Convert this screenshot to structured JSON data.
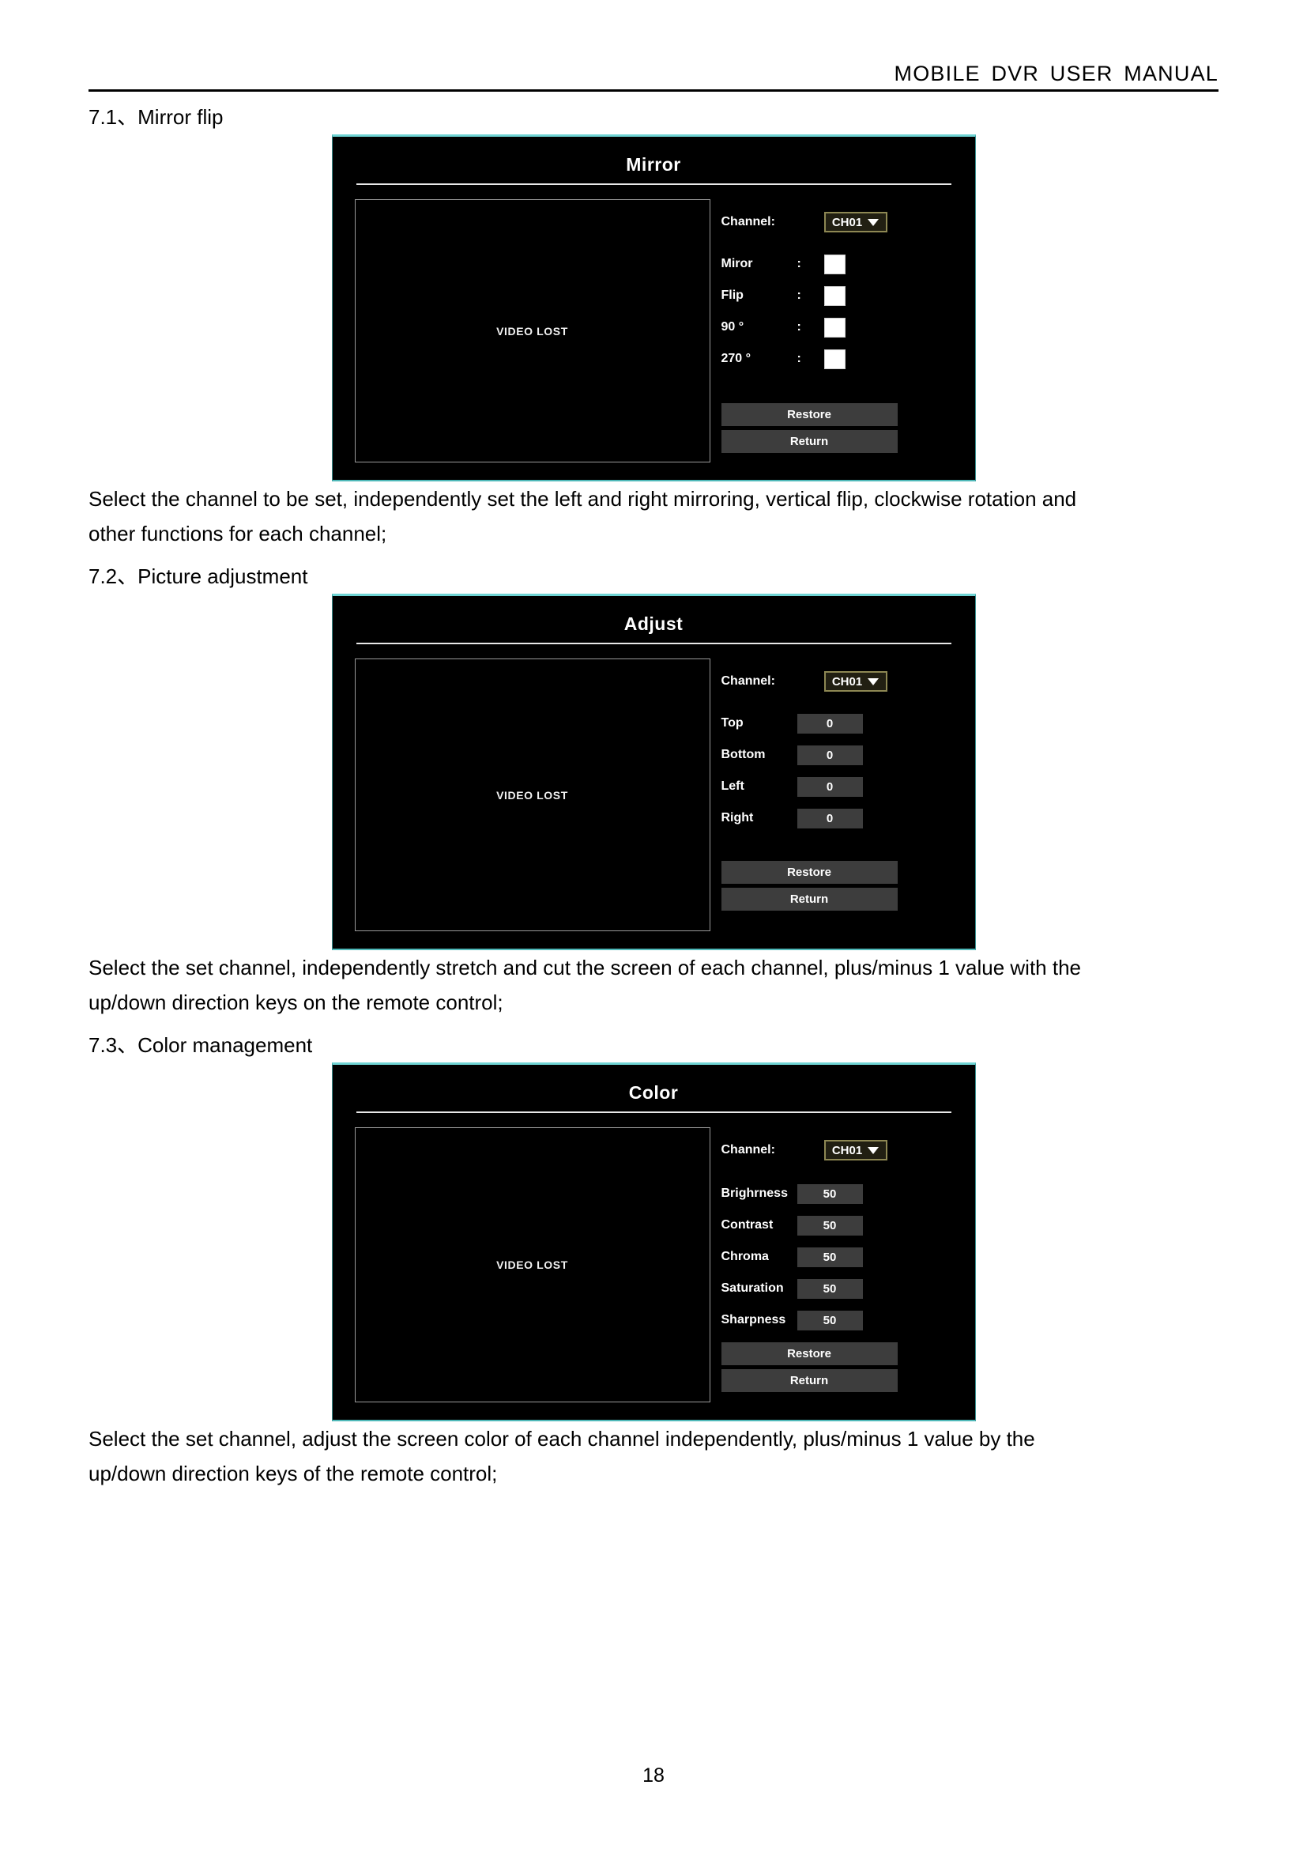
{
  "header": {
    "title": "MOBILE  DVR  USER  MANUAL"
  },
  "sections": [
    {
      "heading": "7.1、Mirror flip",
      "dialog": {
        "title": "Mirror",
        "video_placeholder": "VIDEO LOST",
        "channel_label": "Channel:",
        "channel_value": "CH01",
        "rows": [
          {
            "label": "Miror",
            "colon": ":",
            "control": "checkbox"
          },
          {
            "label": "Flip",
            "colon": ":",
            "control": "checkbox"
          },
          {
            "label": "90 °",
            "colon": ":",
            "control": "checkbox"
          },
          {
            "label": "270 °",
            "colon": ":",
            "control": "checkbox"
          }
        ],
        "buttons": [
          {
            "label": "Restore"
          },
          {
            "label": "Return"
          }
        ]
      },
      "paragraph": [
        "Select the channel to be set, independently set the left and right mirroring, vertical flip, clockwise rotation and",
        "other functions for each channel;"
      ]
    },
    {
      "heading": "7.2、Picture adjustment",
      "dialog": {
        "title": "Adjust",
        "video_placeholder": "VIDEO LOST",
        "channel_label": "Channel:",
        "channel_value": "CH01",
        "rows": [
          {
            "label": "Top",
            "value": "0",
            "control": "value"
          },
          {
            "label": "Bottom",
            "value": "0",
            "control": "value"
          },
          {
            "label": "Left",
            "value": "0",
            "control": "value"
          },
          {
            "label": "Right",
            "value": "0",
            "control": "value"
          }
        ],
        "buttons": [
          {
            "label": "Restore"
          },
          {
            "label": "Return"
          }
        ]
      },
      "paragraph": [
        "Select the set channel, independently stretch and cut the screen of each channel, plus/minus 1 value with the",
        "up/down direction keys on the remote control;"
      ]
    },
    {
      "heading": "7.3、Color management",
      "dialog": {
        "title": "Color",
        "video_placeholder": "VIDEO LOST",
        "channel_label": "Channel:",
        "channel_value": "CH01",
        "rows": [
          {
            "label": "Brighrness",
            "value": "50",
            "control": "value"
          },
          {
            "label": "Contrast",
            "value": "50",
            "control": "value"
          },
          {
            "label": "Chroma",
            "value": "50",
            "control": "value"
          },
          {
            "label": "Saturation",
            "value": "50",
            "control": "value"
          },
          {
            "label": "Sharpness",
            "value": "50",
            "control": "value"
          }
        ],
        "buttons": [
          {
            "label": "Restore"
          },
          {
            "label": "Return"
          }
        ]
      },
      "paragraph": [
        "Select the set channel, adjust the screen color of each channel independently, plus/minus 1 value by the",
        "up/down direction keys of the remote control;"
      ]
    }
  ],
  "footer": {
    "page_number": "18"
  },
  "colors": {
    "dialog_accent": "#6fd4d4",
    "dialog_background": "#000000",
    "control_fill": "#3d3d3d",
    "dropdown_border": "#8d8753",
    "checkbox_fill": "#ffffff"
  }
}
